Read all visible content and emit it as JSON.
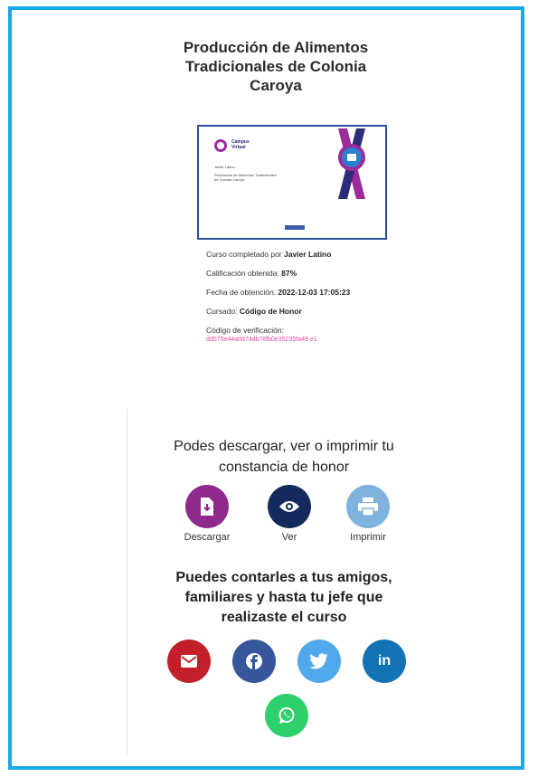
{
  "course": {
    "title_line1": "Producción de Alimentos",
    "title_line2": "Tradicionales de Colonia",
    "title_line3": "Caroya"
  },
  "certificate": {
    "brand_line1": "Campus",
    "brand_line2": "Virtual",
    "student_name": "Javier Latino",
    "course_line1": "Producción de Alimentos Tradicionales",
    "course_line2": "de Colonia Caroya"
  },
  "details": {
    "completed_by_label": "Curso completado por ",
    "completed_by_value": "Javier Latino",
    "grade_label": "Calificación obtenida: ",
    "grade_value": "87%",
    "date_label": "Fecha de obtención: ",
    "date_value": "2022-12-03 17:05:23",
    "track_label": "Cursado: ",
    "track_value": "Código de Honor",
    "verification_label": "Código de verificación:",
    "verification_code": "dd075e44a0d74db78fb0e35235fa49 e1"
  },
  "download": {
    "title_line1": "Podes descargar, ver o imprimir tu",
    "title_line2": "constancia de honor",
    "actions": [
      {
        "label": "Descargar",
        "icon": "download-file-icon",
        "color": "#8e2a8c"
      },
      {
        "label": "Ver",
        "icon": "eye-icon",
        "color": "#142a5c"
      },
      {
        "label": "Imprimir",
        "icon": "printer-icon",
        "color": "#7fb3dd"
      }
    ]
  },
  "share": {
    "title_line1": "Puedes contarles a tus amigos,",
    "title_line2": "familiares y hasta tu jefe que",
    "title_line3": "realizaste el curso",
    "buttons": [
      {
        "name": "email",
        "icon": "email-icon",
        "color": "#c21f2a"
      },
      {
        "name": "facebook",
        "icon": "facebook-icon",
        "color": "#36579b"
      },
      {
        "name": "twitter",
        "icon": "twitter-icon",
        "color": "#50a9ea"
      },
      {
        "name": "linkedin",
        "icon": "linkedin-icon",
        "color": "#1473b4",
        "glyph": "in"
      },
      {
        "name": "whatsapp",
        "icon": "whatsapp-icon",
        "color": "#2ed06b"
      }
    ]
  }
}
